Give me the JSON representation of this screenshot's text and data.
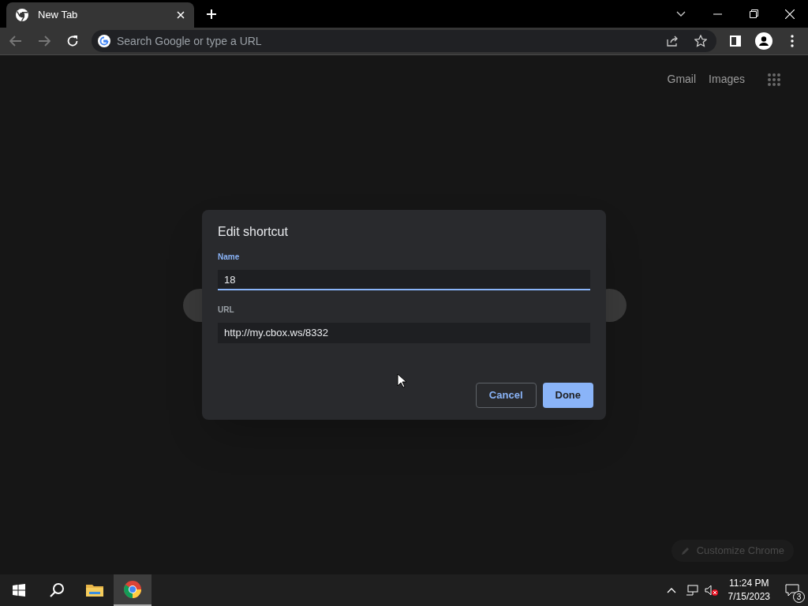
{
  "tabs": [
    {
      "title": "New Tab",
      "selected": true
    }
  ],
  "address_bar": {
    "placeholder": "Search Google or type a URL"
  },
  "top_links": [
    "Gmail",
    "Images"
  ],
  "dialog": {
    "title": "Edit shortcut",
    "fields": [
      {
        "label": "Name",
        "value": "18",
        "focused": true
      },
      {
        "label": "URL",
        "value": "http://my.cbox.ws/8332",
        "focused": false
      }
    ],
    "buttons": [
      {
        "label": "Cancel",
        "kind": "secondary"
      },
      {
        "label": "Done",
        "kind": "primary"
      }
    ]
  },
  "customize_button": "Customize Chrome",
  "taskbar": {
    "apps": [
      {
        "kind": "start"
      },
      {
        "kind": "search"
      },
      {
        "kind": "files"
      },
      {
        "kind": "chrome",
        "selected": true
      }
    ],
    "time": "11:24 PM",
    "date": "7/15/2023",
    "notifications": "3"
  }
}
